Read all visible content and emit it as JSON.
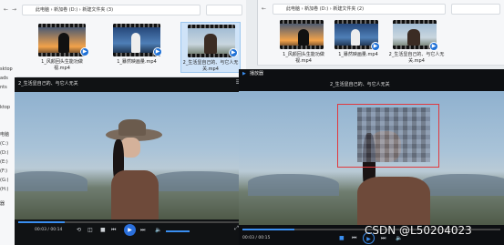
{
  "left_explorer": {
    "address": "此电脑 › 新加卷 (D:) › 新建文件夹 (3)",
    "files": [
      {
        "name": "1_风颜回头生能功做视.mp4",
        "thumb": "sunset"
      },
      {
        "name": "1_暴然映画量.mp4",
        "thumb": "city"
      },
      {
        "name": "2_生活显自己的、与它人无关.mp4",
        "thumb": "hat"
      }
    ],
    "sidebar": [
      "sktop",
      "",
      "ads",
      "nts",
      "",
      "",
      "ktop",
      "",
      "",
      "",
      "电脑",
      "(C:)",
      "(D:)",
      "(E:)",
      "(F:)",
      "(G:)",
      "(H:)",
      "器"
    ]
  },
  "right_explorer": {
    "address": "此电脑 › 新加卷 (D:) › 新建文件夹 (2)",
    "files": [
      {
        "name": "1_风颜回头生能功做视.mp4",
        "thumb": "sunset"
      },
      {
        "name": "1_暴然映画量.mp4",
        "thumb": "city"
      },
      {
        "name": "2_生活显自己的、与它人无关.mp4",
        "thumb": "hat"
      }
    ]
  },
  "left_player": {
    "title": "2_生活显自己的、与它人无关",
    "time": "00:03 / 00:14",
    "progress": 0.21
  },
  "right_player": {
    "app_title": "播放器",
    "title": "2_生活显自己的、与它人无关",
    "time": "00:03 / 00:15",
    "progress": 0.2
  },
  "watermark": "CSDN @L50204023",
  "colors": {
    "accent": "#2a6fdb",
    "highlight": "#e0393e",
    "player_bg": "#101214"
  }
}
